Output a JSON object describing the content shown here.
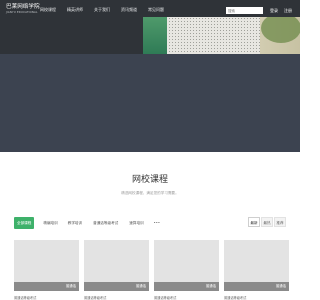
{
  "brand": {
    "title": "巴莱网络学院",
    "subtitle": "JIANYU EDUCATIONAL"
  },
  "nav": {
    "items": [
      "网校课程",
      "精英讲师",
      "关于我们",
      "资讯频道",
      "常见问题"
    ]
  },
  "search": {
    "placeholder": "搜索"
  },
  "auth": {
    "login": "登录",
    "register": "注册"
  },
  "section": {
    "title": "网校课程",
    "subtitle": "精选网校课程，满足您的学习需要。"
  },
  "tabs": {
    "items": [
      "全部课程",
      "精编培训",
      "教学培训",
      "普通话等级考试",
      "速算培训",
      "•••"
    ]
  },
  "view": {
    "items": [
      "最新",
      "最热",
      "推荐"
    ]
  },
  "cards": [
    {
      "tag": "普通话",
      "title": "普通话等级考试"
    },
    {
      "tag": "普通话",
      "title": "普通话等级考试"
    },
    {
      "tag": "普通话",
      "title": "普通话等级考试"
    },
    {
      "tag": "普通话",
      "title": "普通话等级考试"
    }
  ],
  "colors": {
    "accent": "#3eb16a",
    "header": "#2f3338",
    "band": "#3c4350"
  }
}
